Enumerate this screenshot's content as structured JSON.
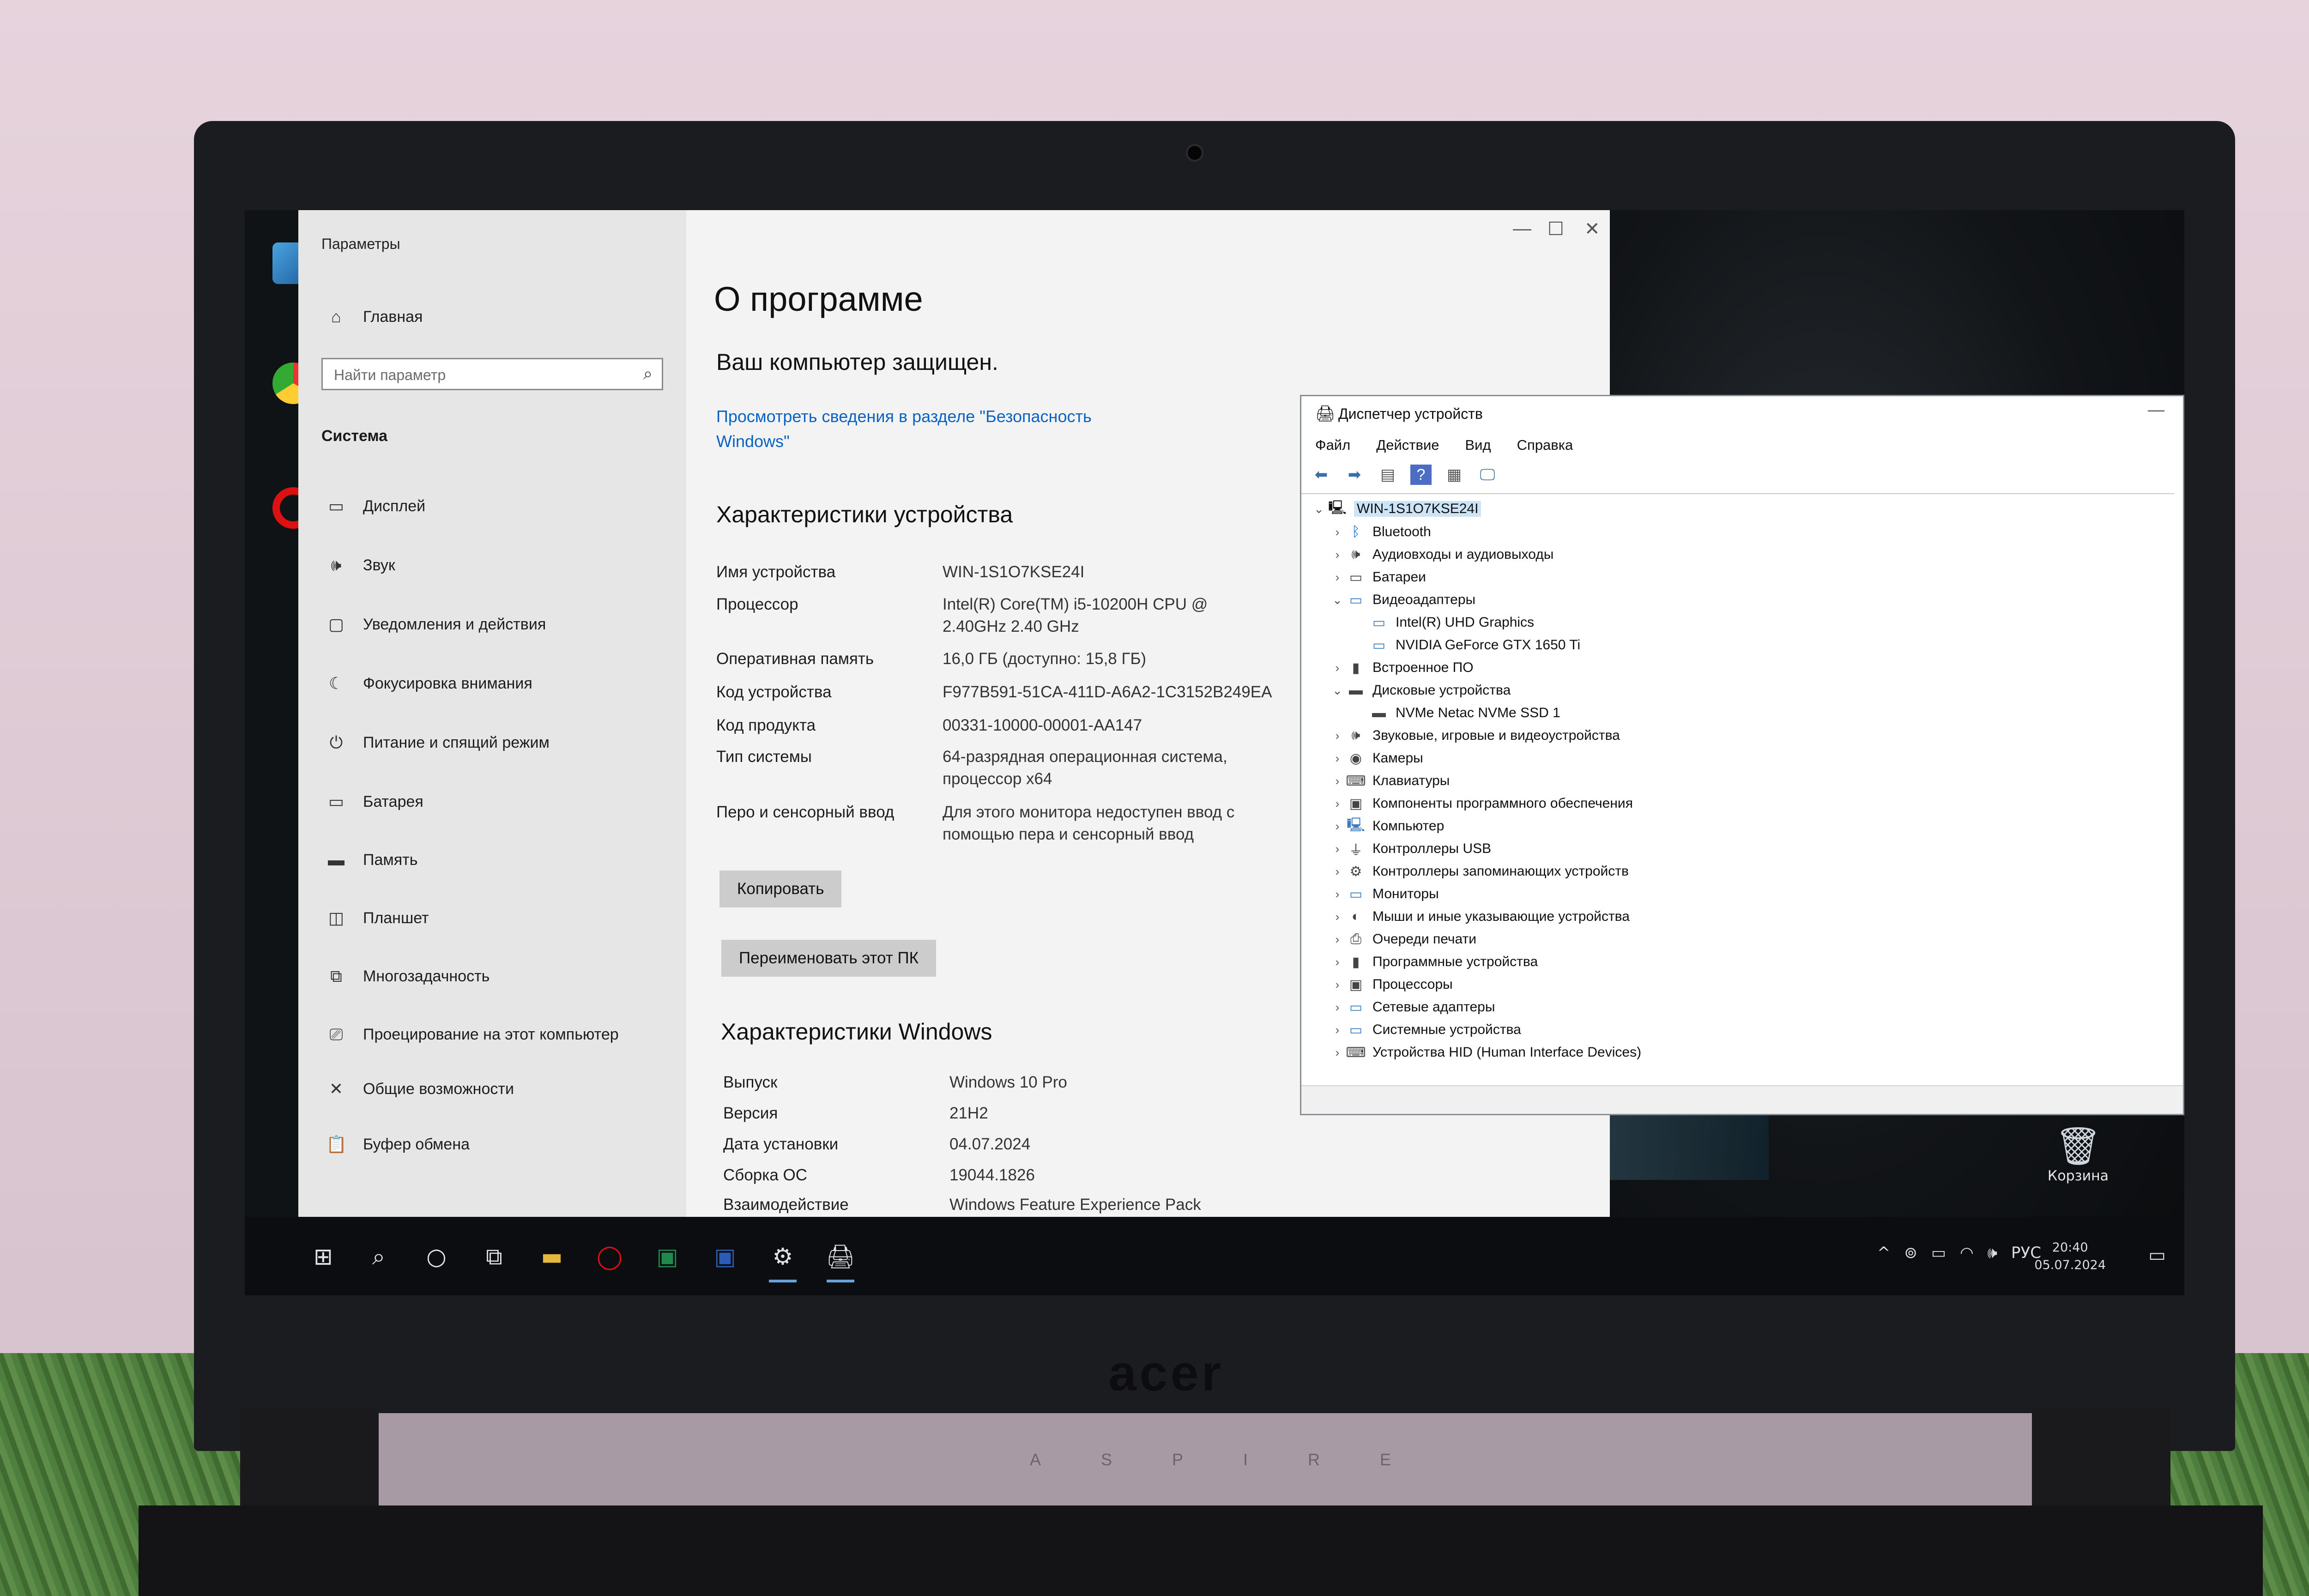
{
  "settings": {
    "window_title": "Параметры",
    "nav": {
      "home": "Главная",
      "search_placeholder": "Найти параметр",
      "section": "Система",
      "items": [
        {
          "label": "Дисплей",
          "icon": "monitor-icon"
        },
        {
          "label": "Звук",
          "icon": "speaker-icon"
        },
        {
          "label": "Уведомления и действия",
          "icon": "notification-icon"
        },
        {
          "label": "Фокусировка внимания",
          "icon": "moon-icon"
        },
        {
          "label": "Питание и спящий режим",
          "icon": "power-icon"
        },
        {
          "label": "Батарея",
          "icon": "battery-icon"
        },
        {
          "label": "Память",
          "icon": "storage-icon"
        },
        {
          "label": "Планшет",
          "icon": "tablet-icon"
        },
        {
          "label": "Многозадачность",
          "icon": "multitask-icon"
        },
        {
          "label": "Проецирование на этот компьютер",
          "icon": "project-icon"
        },
        {
          "label": "Общие возможности",
          "icon": "shared-icon"
        },
        {
          "label": "Буфер обмена",
          "icon": "clipboard-icon"
        }
      ]
    },
    "main": {
      "title": "О программе",
      "protected": "Ваш компьютер защищен.",
      "security_link": "Просмотреть сведения в разделе \"Безопасность Windows\"",
      "device_specs_heading": "Характеристики устройства",
      "device_specs": [
        {
          "label": "Имя устройства",
          "value": "WIN-1S1O7KSE24I"
        },
        {
          "label": "Процессор",
          "value": "Intel(R) Core(TM) i5-10200H CPU @ 2.40GHz   2.40 GHz"
        },
        {
          "label": "Оперативная память",
          "value": "16,0 ГБ (доступно: 15,8 ГБ)"
        },
        {
          "label": "Код устройства",
          "value": "F977B591-51CA-411D-A6A2-1C3152B249EA"
        },
        {
          "label": "Код продукта",
          "value": "00331-10000-00001-AA147"
        },
        {
          "label": "Тип системы",
          "value": "64-разрядная операционная система, процессор x64"
        },
        {
          "label": "Перо и сенсорный ввод",
          "value": "Для этого монитора недоступен ввод с помощью пера и сенсорный ввод"
        }
      ],
      "copy_button": "Копировать",
      "rename_button": "Переименовать этот ПК",
      "windows_specs_heading": "Характеристики Windows",
      "windows_specs": [
        {
          "label": "Выпуск",
          "value": "Windows 10 Pro"
        },
        {
          "label": "Версия",
          "value": "21H2"
        },
        {
          "label": "Дата установки",
          "value": "04.07.2024"
        },
        {
          "label": "Сборка ОС",
          "value": "19044.1826"
        },
        {
          "label": "Взаимодействие",
          "value": "Windows Feature Experience Pack"
        }
      ]
    }
  },
  "device_manager": {
    "title": "Диспетчер устройств",
    "menu": [
      "Файл",
      "Действие",
      "Вид",
      "Справка"
    ],
    "root": "WIN-1S1O7KSE24I",
    "tree": [
      {
        "label": "Bluetooth",
        "level": 1,
        "expanded": false,
        "icon": "bluetooth-icon"
      },
      {
        "label": "Аудиовходы и аудиовыходы",
        "level": 1,
        "expanded": false,
        "icon": "audio-icon"
      },
      {
        "label": "Батареи",
        "level": 1,
        "expanded": false,
        "icon": "battery-icon"
      },
      {
        "label": "Видеоадаптеры",
        "level": 1,
        "expanded": true,
        "icon": "display-adapter-icon"
      },
      {
        "label": "Intel(R) UHD Graphics",
        "level": 2,
        "icon": "display-adapter-icon"
      },
      {
        "label": "NVIDIA GeForce GTX 1650 Ti",
        "level": 2,
        "icon": "display-adapter-icon"
      },
      {
        "label": "Встроенное ПО",
        "level": 1,
        "expanded": false,
        "icon": "firmware-icon"
      },
      {
        "label": "Дисковые устройства",
        "level": 1,
        "expanded": true,
        "icon": "disk-icon"
      },
      {
        "label": "NVMe Netac NVMe SSD 1",
        "level": 2,
        "icon": "disk-icon"
      },
      {
        "label": "Звуковые, игровые и видеоустройства",
        "level": 1,
        "expanded": false,
        "icon": "sound-icon"
      },
      {
        "label": "Камеры",
        "level": 1,
        "expanded": false,
        "icon": "camera-icon"
      },
      {
        "label": "Клавиатуры",
        "level": 1,
        "expanded": false,
        "icon": "keyboard-icon"
      },
      {
        "label": "Компоненты программного обеспечения",
        "level": 1,
        "expanded": false,
        "icon": "software-component-icon"
      },
      {
        "label": "Компьютер",
        "level": 1,
        "expanded": false,
        "icon": "computer-icon"
      },
      {
        "label": "Контроллеры USB",
        "level": 1,
        "expanded": false,
        "icon": "usb-icon"
      },
      {
        "label": "Контроллеры запоминающих устройств",
        "level": 1,
        "expanded": false,
        "icon": "storage-controller-icon"
      },
      {
        "label": "Мониторы",
        "level": 1,
        "expanded": false,
        "icon": "monitor-icon"
      },
      {
        "label": "Мыши и иные указывающие устройства",
        "level": 1,
        "expanded": false,
        "icon": "mouse-icon"
      },
      {
        "label": "Очереди печати",
        "level": 1,
        "expanded": false,
        "icon": "printer-icon"
      },
      {
        "label": "Программные устройства",
        "level": 1,
        "expanded": false,
        "icon": "software-device-icon"
      },
      {
        "label": "Процессоры",
        "level": 1,
        "expanded": false,
        "icon": "processor-icon"
      },
      {
        "label": "Сетевые адаптеры",
        "level": 1,
        "expanded": false,
        "icon": "network-icon"
      },
      {
        "label": "Системные устройства",
        "level": 1,
        "expanded": false,
        "icon": "system-device-icon"
      },
      {
        "label": "Устройства HID (Human Interface Devices)",
        "level": 1,
        "expanded": false,
        "icon": "hid-icon"
      }
    ]
  },
  "desktop": {
    "recycle_bin": "Корзина"
  },
  "laptop": {
    "brand": "acer",
    "model": "ASPIRE"
  },
  "taskbar": {
    "language": "РУС",
    "time": "20:40",
    "date": "05.07.2024"
  }
}
